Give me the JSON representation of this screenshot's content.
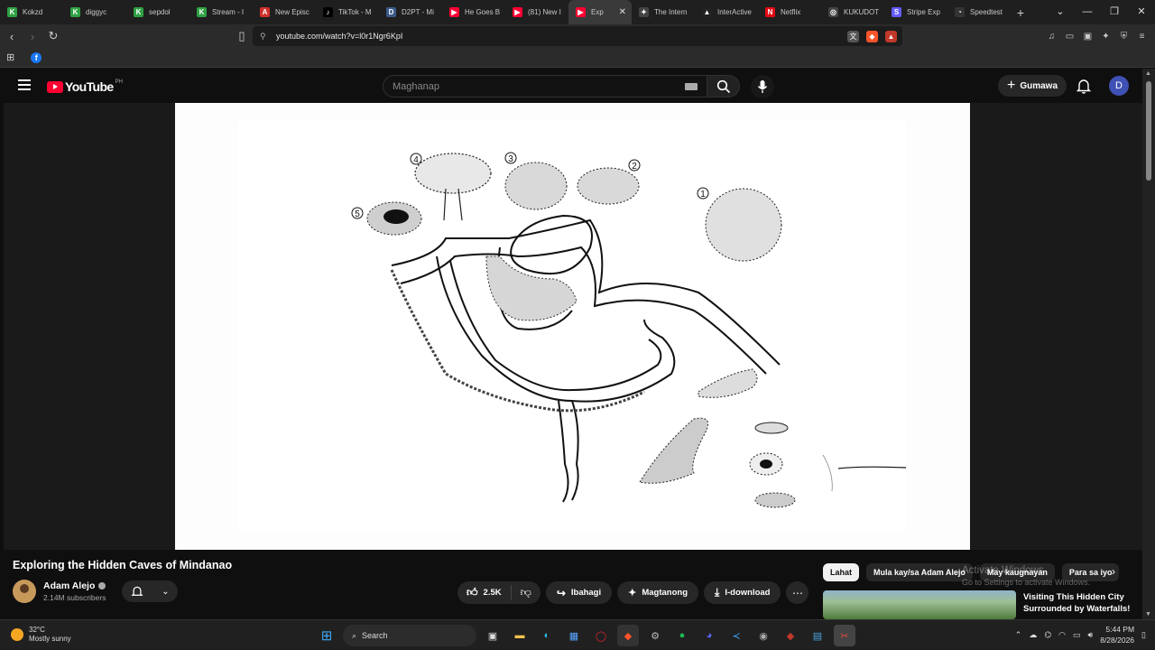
{
  "browser": {
    "tabs": [
      {
        "label": "Kokzd",
        "color": "#2ea043",
        "glyph": "K"
      },
      {
        "label": "diggyc",
        "color": "#2ea043",
        "glyph": "K"
      },
      {
        "label": "sepdol",
        "color": "#2ea043",
        "glyph": "K"
      },
      {
        "label": "Stream - I",
        "color": "#2ea043",
        "glyph": "K"
      },
      {
        "label": "New Episc",
        "color": "#d0302a",
        "glyph": "A"
      },
      {
        "label": "TikTok - M",
        "color": "#000000",
        "glyph": "♪"
      },
      {
        "label": "D2PT - Mi",
        "color": "#3b5b8a",
        "glyph": "D"
      },
      {
        "label": "He Goes B",
        "color": "#ff0033",
        "glyph": "▶"
      },
      {
        "label": "(81) New I",
        "color": "#ff0033",
        "glyph": "▶"
      },
      {
        "label": "Exp",
        "color": "#ff0033",
        "glyph": "▶"
      },
      {
        "label": "The Intern",
        "color": "#444444",
        "glyph": "✦"
      },
      {
        "label": "InterActive",
        "color": "#222222",
        "glyph": "▲"
      },
      {
        "label": "Netflix",
        "color": "#e50914",
        "glyph": "N"
      },
      {
        "label": "KUKUDOT",
        "color": "#444444",
        "glyph": "◎"
      },
      {
        "label": "Stripe Exp",
        "color": "#635bff",
        "glyph": "S"
      },
      {
        "label": "Speedtest",
        "color": "#333333",
        "glyph": "◔"
      }
    ],
    "active_tab_index": 9,
    "url": "youtube.com/watch?v=l0r1Ngr6KpI"
  },
  "youtube": {
    "logo_text": "YouTube",
    "region": "PH",
    "search_placeholder": "Maghanap",
    "create_label": "Gumawa",
    "avatar_letter": "D",
    "video": {
      "title": "Exploring the Hidden Caves of Mindanao",
      "channel": "Adam Alejo",
      "subscribers": "2.14M subscribers",
      "likes": "2.5K",
      "share_label": "Ibahagi",
      "ask_label": "Magtanong",
      "download_label": "I-download"
    },
    "chips": [
      {
        "label": "Lahat",
        "active": true
      },
      {
        "label": "Mula kay/sa Adam Alejo",
        "active": false
      },
      {
        "label": "May kaugnayan",
        "active": false
      },
      {
        "label": "Para sa iyo",
        "active": false
      }
    ],
    "recommended": {
      "title": "Visiting This Hidden City Surrounded by Waterfalls!"
    },
    "activation": {
      "line1": "Activate Windows",
      "line2": "Go to Settings to activate Windows."
    }
  },
  "map_labels": [
    "1",
    "2",
    "3",
    "4",
    "5"
  ],
  "taskbar": {
    "temperature": "32°C",
    "weather": "Mostly sunny",
    "search_label": "Search",
    "time": "5:44 PM",
    "date": "8/28/2026"
  }
}
